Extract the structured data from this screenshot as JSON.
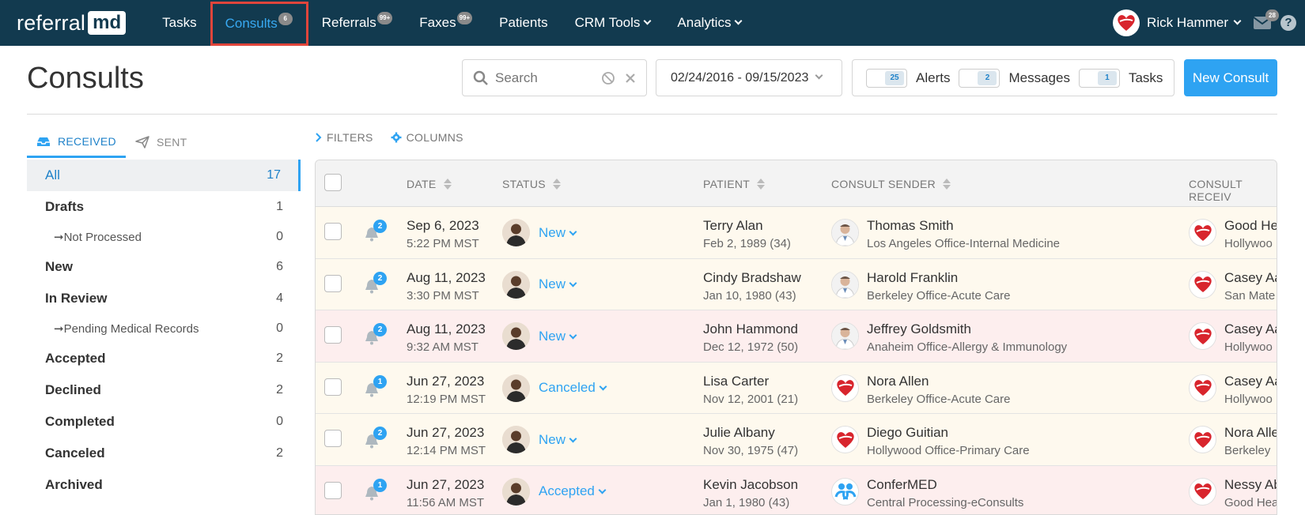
{
  "nav": {
    "logo_text": "referral",
    "logo_box": "md",
    "items": [
      {
        "label": "Tasks",
        "badge": ""
      },
      {
        "label": "Consults",
        "badge": "6"
      },
      {
        "label": "Referrals",
        "badge": "99+"
      },
      {
        "label": "Faxes",
        "badge": "99+"
      },
      {
        "label": "Patients",
        "badge": ""
      },
      {
        "label": "CRM Tools",
        "badge": ""
      },
      {
        "label": "Analytics",
        "badge": ""
      }
    ],
    "user_name": "Rick Hammer",
    "mail_badge": "28",
    "help": "?"
  },
  "header": {
    "title": "Consults",
    "search_placeholder": "Search",
    "date_range": "02/24/2016 - 09/15/2023",
    "alerts_count": "25",
    "alerts_label": "Alerts",
    "messages_count": "2",
    "messages_label": "Messages",
    "tasks_count": "1",
    "tasks_label": "Tasks",
    "new_consult": "New Consult"
  },
  "sidebar": {
    "tabs": [
      {
        "label": "RECEIVED"
      },
      {
        "label": "SENT"
      }
    ],
    "items": [
      {
        "label": "All",
        "count": "17"
      },
      {
        "label": "Drafts",
        "count": "1"
      },
      {
        "label": "Not Processed",
        "count": "0"
      },
      {
        "label": "New",
        "count": "6"
      },
      {
        "label": "In Review",
        "count": "4"
      },
      {
        "label": "Pending Medical Records",
        "count": "0"
      },
      {
        "label": "Accepted",
        "count": "2"
      },
      {
        "label": "Declined",
        "count": "2"
      },
      {
        "label": "Completed",
        "count": "0"
      },
      {
        "label": "Canceled",
        "count": "2"
      },
      {
        "label": "Archived",
        "count": ""
      }
    ]
  },
  "tools": {
    "filters": "FILTERS",
    "columns": "COLUMNS"
  },
  "table": {
    "columns": [
      "DATE",
      "STATUS",
      "PATIENT",
      "CONSULT SENDER",
      "CONSULT RECEIV"
    ],
    "rows": [
      {
        "bell": "2",
        "date": "Sep 6, 2023",
        "time": "5:22 PM MST",
        "status": "New",
        "patient": "Terry Alan",
        "dob": "Feb 2, 1989 (34)",
        "sender": "Thomas Smith",
        "sender_org": "Los Angeles Office-Internal Medicine",
        "sender_icon": "doctor-avatar",
        "receiver": "Good He",
        "receiver_org": "Hollywoo"
      },
      {
        "bell": "2",
        "date": "Aug 11, 2023",
        "time": "3:30 PM MST",
        "status": "New",
        "patient": "Cindy Bradshaw",
        "dob": "Jan 10, 1980 (43)",
        "sender": "Harold Franklin",
        "sender_org": "Berkeley Office-Acute Care",
        "sender_icon": "doctor-avatar",
        "receiver": "Casey Aa",
        "receiver_org": "San Mate"
      },
      {
        "bell": "2",
        "date": "Aug 11, 2023",
        "time": "9:32 AM MST",
        "status": "New",
        "patient": "John Hammond",
        "dob": "Dec 12, 1972 (50)",
        "sender": "Jeffrey Goldsmith",
        "sender_org": "Anaheim Office-Allergy & Immunology",
        "sender_icon": "doctor-avatar",
        "receiver": "Casey Aa",
        "receiver_org": "Hollywoo"
      },
      {
        "bell": "1",
        "date": "Jun 27, 2023",
        "time": "12:19 PM MST",
        "status": "Canceled",
        "patient": "Lisa Carter",
        "dob": "Nov 12, 2001 (21)",
        "sender": "Nora Allen",
        "sender_org": "Berkeley Office-Acute Care",
        "sender_icon": "heart-logo",
        "receiver": "Casey Aa",
        "receiver_org": "Hollywoo"
      },
      {
        "bell": "2",
        "date": "Jun 27, 2023",
        "time": "12:14 PM MST",
        "status": "New",
        "patient": "Julie Albany",
        "dob": "Nov 30, 1975 (47)",
        "sender": "Diego Guitian",
        "sender_org": "Hollywood Office-Primary Care",
        "sender_icon": "heart-logo",
        "receiver": "Nora Alle",
        "receiver_org": "Berkeley"
      },
      {
        "bell": "1",
        "date": "Jun 27, 2023",
        "time": "11:56 AM MST",
        "status": "Accepted",
        "patient": "Kevin Jacobson",
        "dob": "Jan 1, 1980 (43)",
        "sender": "ConferMED",
        "sender_org": "Central Processing-eConsults",
        "sender_icon": "confermed-logo",
        "receiver": "Nessy Ab",
        "receiver_org": "Good Hea"
      }
    ]
  },
  "colors": {
    "nav_bg": "#123a4f",
    "accent": "#2ea3f2",
    "highlight_border": "#e0453b",
    "row_cream": "#fef9ee",
    "row_pink": "#fdeeee"
  }
}
